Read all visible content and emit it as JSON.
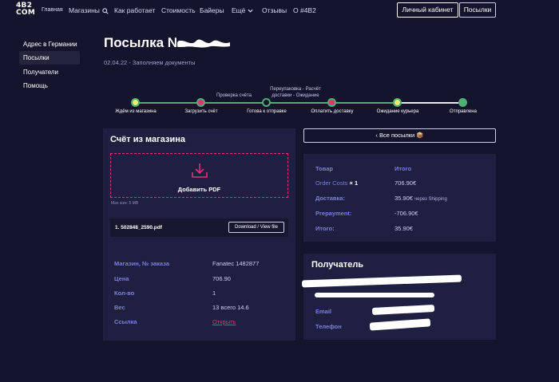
{
  "nav": {
    "logo_line1": "4B2",
    "logo_line2": "COM",
    "home": "Главная",
    "shops": "Магазины",
    "how": "Как работает",
    "price": "Стоимость",
    "buyers": "Байеры",
    "more": "Ещё",
    "reviews": "Отзывы",
    "about": "О #4B2",
    "cabinet": "Личный кабинет",
    "parcels": "Посылки"
  },
  "sidebar": {
    "items": [
      {
        "label": "Адрес в Германии"
      },
      {
        "label": "Посылки"
      },
      {
        "label": "Получатели"
      },
      {
        "label": "Помощь"
      }
    ]
  },
  "page": {
    "title": "Посылка №",
    "subtitle": "02.04.22 - Заполняем документы"
  },
  "progress": {
    "steps": [
      {
        "label": "Ждём из магазина",
        "above": ""
      },
      {
        "label": "Загрузить счёт",
        "above": "Проверка счёта"
      },
      {
        "label": "Готова к отправке",
        "above": "Переупаковка - Расчёт доставки - Ожидание"
      },
      {
        "label": "Оплатить доставку",
        "above": ""
      },
      {
        "label": "Ожидание курьера",
        "above": ""
      },
      {
        "label": "Отправлена",
        "above": ""
      }
    ]
  },
  "invoice": {
    "title": "Счёт из магазина",
    "upload_label": "Добавить PDF",
    "max_size": "Max size: 5 MB",
    "file_name": "1. 502848_2590.pdf",
    "file_button": "Download / View file",
    "rows": [
      {
        "label": "Магазин, № заказа",
        "value": "Fanatec 1482877"
      },
      {
        "label": "Цена",
        "value": "706.90"
      },
      {
        "label": "Кол-во",
        "value": "1"
      },
      {
        "label": "Вес",
        "value": "13 всего 14.6"
      },
      {
        "label": "Ссылка",
        "value": "Открыть"
      }
    ]
  },
  "back_button": "‹ Все посылки 📦",
  "summary": {
    "col_product": "Товар",
    "col_total": "Итого",
    "rows": [
      {
        "label": "Order Costs",
        "qty": "× 1",
        "value": "706.90€",
        "note": ""
      },
      {
        "label": "Доставка:",
        "qty": "",
        "value": "35.90€",
        "note": "через Shipping"
      },
      {
        "label": "Prepayment:",
        "qty": "",
        "value": "-706.90€",
        "note": ""
      },
      {
        "label": "Итого:",
        "qty": "",
        "value": "35.90€",
        "note": ""
      }
    ]
  },
  "recipient": {
    "title": "Получатель",
    "email_label": "Email",
    "phone_label": "Телефон"
  },
  "colors": {
    "background": "#14142d",
    "panel": "#1f1f42",
    "accent_pink": "#e0337a",
    "accent_green": "#4caf74",
    "label_blue": "#7c80d4"
  }
}
